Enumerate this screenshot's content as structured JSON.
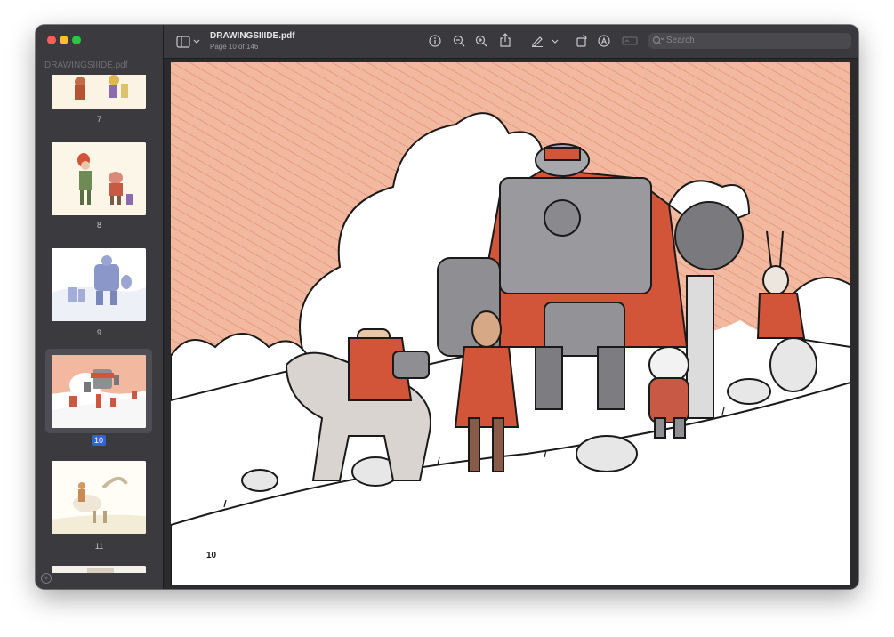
{
  "window": {
    "sidebar_title": "DRAWINGSIIIDE.pdf",
    "doc_title": "DRAWINGSIIIDE.pdf",
    "page_status": "Page 10 of 146"
  },
  "toolbar": {
    "search_placeholder": "Search",
    "icons": [
      "sidebar-toggle-icon",
      "chevron-down-icon",
      "info-icon",
      "zoom-out-icon",
      "zoom-in-icon",
      "share-icon",
      "markup-pen-icon",
      "chevron-down-icon",
      "rotate-icon",
      "annotate-icon",
      "form-fill-icon",
      "search-icon"
    ]
  },
  "sidebar": {
    "thumbnails": [
      {
        "label": "7"
      },
      {
        "label": "8"
      },
      {
        "label": "9"
      },
      {
        "label": "10",
        "selected": true
      },
      {
        "label": "11"
      }
    ]
  },
  "page": {
    "page_number": "10"
  },
  "colors": {
    "selection": "#2b66d9",
    "sidebar_bg": "#3b3a3f",
    "toolbar_bg": "#3a393e",
    "wash": "#f2b9a0",
    "cape": "#d2553a"
  }
}
